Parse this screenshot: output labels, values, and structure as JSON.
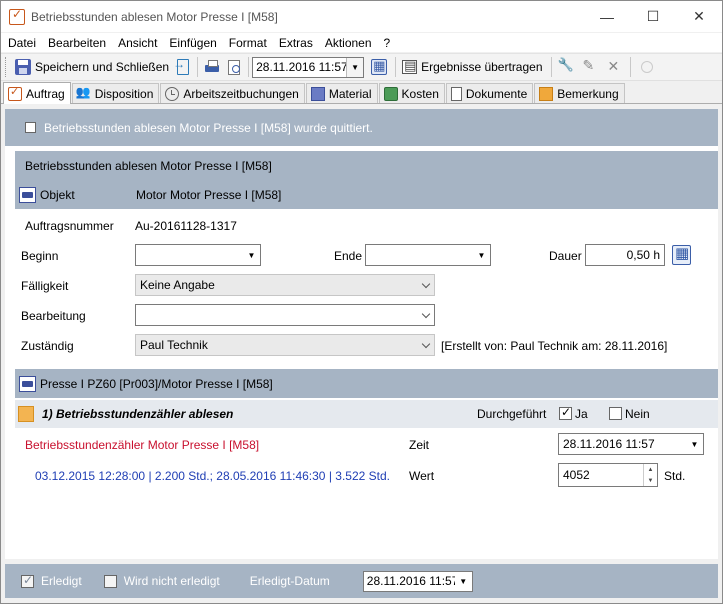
{
  "window": {
    "title": "Betriebsstunden ablesen Motor Presse I [M58]",
    "minimize": "—",
    "maximize": "☐",
    "close": "✕"
  },
  "menu": [
    {
      "label": "Datei"
    },
    {
      "label": "Bearbeiten"
    },
    {
      "label": "Ansicht"
    },
    {
      "label": "Einfügen"
    },
    {
      "label": "Format"
    },
    {
      "label": "Extras"
    },
    {
      "label": "Aktionen"
    },
    {
      "label": "?"
    }
  ],
  "toolbar": {
    "save_close_label": "Speichern und Schließen",
    "date_value": "28.11.2016 11:57",
    "transfer_label": "Ergebnisse übertragen"
  },
  "tabs": [
    {
      "label": "Auftrag",
      "active": true
    },
    {
      "label": "Disposition"
    },
    {
      "label": "Arbeitszeitbuchungen"
    },
    {
      "label": "Material"
    },
    {
      "label": "Kosten"
    },
    {
      "label": "Dokumente"
    },
    {
      "label": "Bemerkung"
    }
  ],
  "quit_notice": "Betriebsstunden ablesen Motor Presse I [M58] wurde quittiert.",
  "panel": {
    "title": "Betriebsstunden ablesen Motor Presse I [M58]",
    "objekt_label": "Objekt",
    "objekt_value": "Motor Motor Presse I [M58]",
    "auftragsnummer_label": "Auftragsnummer",
    "auftragsnummer_value": "Au-20161128-1317",
    "beginn_label": "Beginn",
    "beginn_value": "",
    "ende_label": "Ende",
    "ende_value": "",
    "dauer_label": "Dauer",
    "dauer_value": "0,50 h",
    "faelligkeit_label": "Fälligkeit",
    "faelligkeit_value": "Keine Angabe",
    "bearbeitung_label": "Bearbeitung",
    "bearbeitung_value": "",
    "zustaendig_label": "Zuständig",
    "zustaendig_value": "Paul Technik",
    "created_info": "[Erstellt von: Paul Technik am: 28.11.2016]"
  },
  "machine": {
    "title": "Presse I PZ60 [Pr003]/Motor Presse I [M58]",
    "task_title": "1) Betriebsstundenzähler ablesen",
    "durchgefuehrt_label": "Durchgeführt",
    "ja_label": "Ja",
    "ja_checked": true,
    "nein_label": "Nein",
    "nein_checked": false,
    "counter_name": "Betriebsstundenzähler Motor Presse I [M58]",
    "history": "03.12.2015 12:28:00 | 2.200 Std.; 28.05.2016 11:46:30 | 3.522 Std.",
    "zeit_label": "Zeit",
    "zeit_value": "28.11.2016 11:57",
    "wert_label": "Wert",
    "wert_value": "4052",
    "wert_unit": "Std."
  },
  "footer": {
    "erledigt_label": "Erledigt",
    "erledigt_checked": true,
    "nicht_erledigt_label": "Wird nicht erledigt",
    "nicht_erledigt_checked": false,
    "erledigt_datum_label": "Erledigt-Datum",
    "erledigt_datum_value": "28.11.2016 11:57"
  },
  "colors": {
    "band": "#a6b4c4",
    "task_band": "#e5e9ee",
    "counter_red": "#c8102e",
    "history_blue": "#1f3eb4",
    "accent_orange": "#c7571b"
  }
}
